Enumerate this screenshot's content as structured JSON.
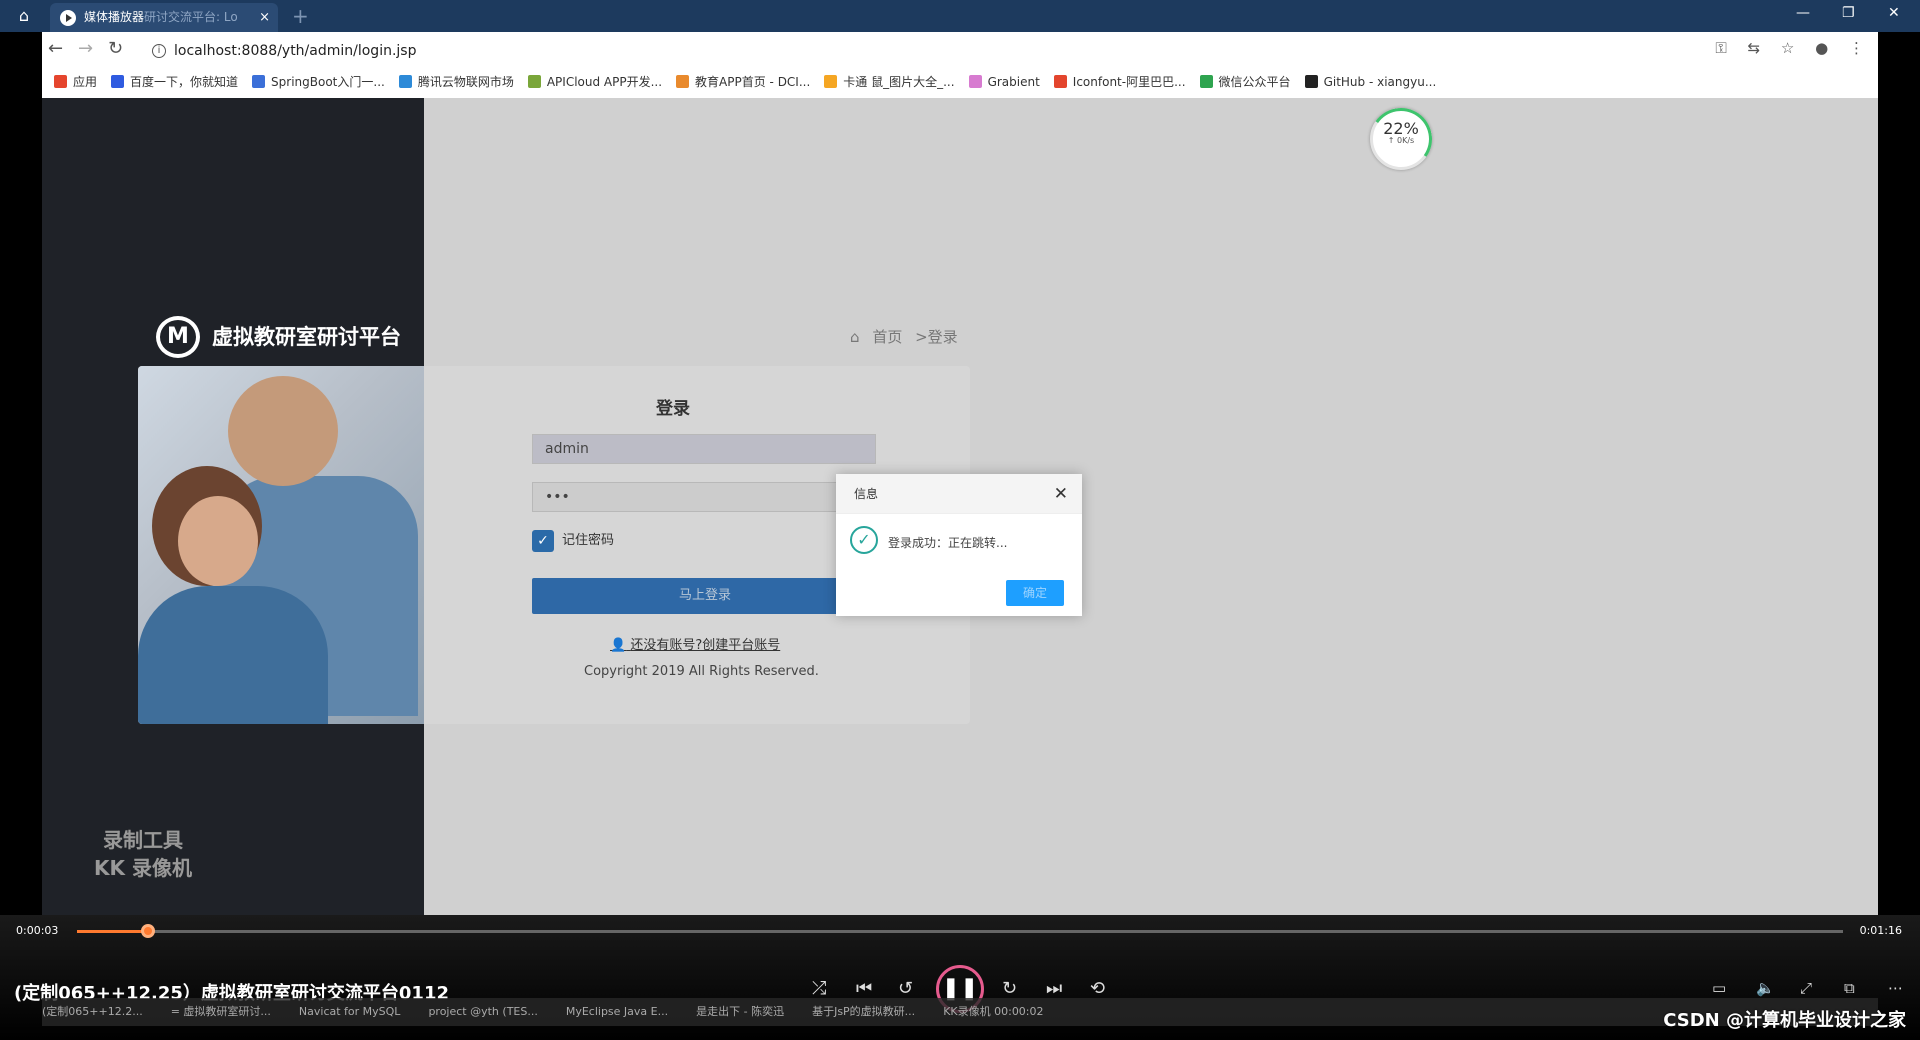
{
  "titlebar": {
    "tab_title": "媒体播放器",
    "tab_subtitle": "研讨交流平台: Lo",
    "tab_close": "×",
    "new_tab": "+",
    "minimize": "—",
    "maximize": "❐",
    "close": "✕"
  },
  "browser": {
    "url": "localhost:8088/yth/admin/login.jsp",
    "bookmarks": [
      {
        "label": "应用",
        "color": "#e5452d"
      },
      {
        "label": "百度一下，你就知道",
        "color": "#2f5be0"
      },
      {
        "label": "SpringBoot入门一...",
        "color": "#3b6fd8"
      },
      {
        "label": "腾讯云物联网市场",
        "color": "#2d8ad8"
      },
      {
        "label": "APICloud APP开发...",
        "color": "#7aa63a"
      },
      {
        "label": "教育APP首页 - DCI...",
        "color": "#e98a2d"
      },
      {
        "label": "卡通 鼠_图片大全_...",
        "color": "#f5a623"
      },
      {
        "label": "Grabient",
        "color": "#d77bd0"
      },
      {
        "label": "Iconfont-阿里巴巴...",
        "color": "#e3452d"
      },
      {
        "label": "微信公众平台",
        "color": "#2ea44f"
      },
      {
        "label": "GitHub - xiangyu...",
        "color": "#222222"
      }
    ]
  },
  "page": {
    "logo_text": "虚拟教研室研讨平台",
    "breadcrumb_home": "首页",
    "breadcrumb_current": ">登录",
    "login_title": "登录",
    "username_value": "admin",
    "password_value": "•••",
    "remember_label": "记住密码",
    "login_button": "马上登录",
    "register_link": "还没有账号?创建平台账号",
    "copyright": "Copyright 2019 All Rights Reserved.",
    "speed_percent": "22%",
    "speed_rate": "↑ 0K/s",
    "watermark_line1": "录制工具",
    "watermark_line2": "KK 录像机"
  },
  "dialog": {
    "title": "信息",
    "message": "登录成功：正在跳转...",
    "button": "确定"
  },
  "player": {
    "time_current": "0:00:03",
    "time_total": "0:01:16",
    "progress": 0.04,
    "video_title": "(定制065++12.25）虚拟教研室研讨交流平台0112"
  },
  "taskbar": {
    "items": [
      "(定制065++12.2...",
      "= 虚拟教研室研讨...",
      "Navicat for MySQL",
      "project @yth (TES...",
      "MyEclipse Java E...",
      "是走出下 - 陈奕迅",
      "基于JsP的虚拟教研...",
      "KK录像机 00:00:02"
    ]
  },
  "watermark_csdn": "CSDN @计算机毕业设计之家"
}
